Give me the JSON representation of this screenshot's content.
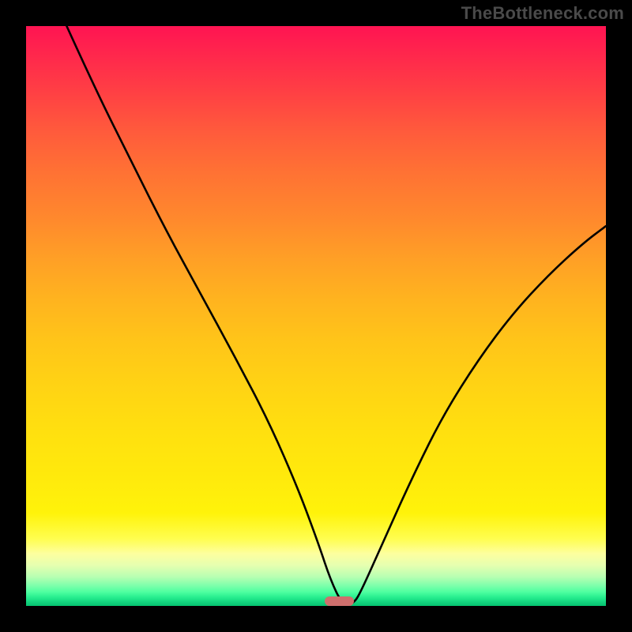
{
  "watermark": "TheBottleneck.com",
  "chart_data": {
    "type": "line",
    "title": "",
    "xlabel": "",
    "ylabel": "",
    "xlim": [
      0,
      100
    ],
    "ylim": [
      0,
      100
    ],
    "grid": false,
    "legend": false,
    "series": [
      {
        "name": "bottleneck-curve",
        "x": [
          7,
          12,
          18,
          24,
          30,
          36,
          42,
          47,
          50.5,
          52.5,
          54.5,
          56.5,
          58,
          62,
          67,
          72,
          78,
          84,
          90,
          96,
          100
        ],
        "values": [
          100,
          89,
          77,
          65,
          54,
          43,
          31.5,
          20,
          10.5,
          4.5,
          0.3,
          0.3,
          3,
          12,
          23,
          33,
          42.5,
          50.5,
          57,
          62.5,
          65.5
        ]
      }
    ],
    "optimal_marker": {
      "x_start": 51.5,
      "x_end": 56.5,
      "y": 0
    },
    "gradient_stops": [
      {
        "pct": 0,
        "color": "#ff1452"
      },
      {
        "pct": 25,
        "color": "#ff7134"
      },
      {
        "pct": 50,
        "color": "#ffc018"
      },
      {
        "pct": 85,
        "color": "#fff30a"
      },
      {
        "pct": 92,
        "color": "#f0ffaa"
      },
      {
        "pct": 97,
        "color": "#60ffa5"
      },
      {
        "pct": 100,
        "color": "#05c270"
      }
    ]
  }
}
